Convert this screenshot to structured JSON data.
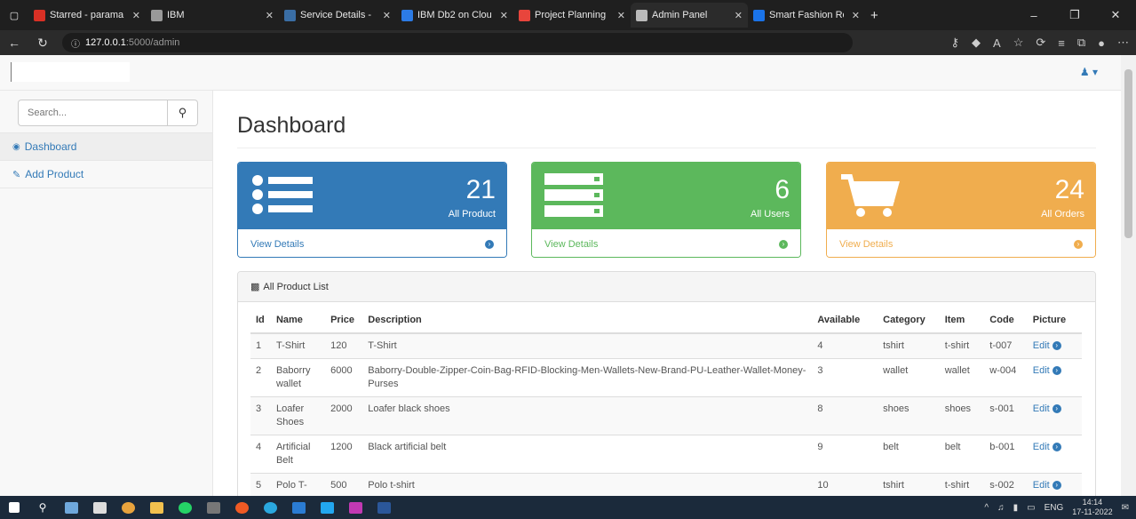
{
  "browser": {
    "tabs": [
      {
        "label": "Starred - parama",
        "color": "#d93025",
        "active": false
      },
      {
        "label": "IBM",
        "color": "#999999",
        "active": false
      },
      {
        "label": "Service Details - I",
        "color": "#3a6ea5",
        "active": false
      },
      {
        "label": "IBM Db2 on Clou",
        "color": "#2c7be5",
        "active": false
      },
      {
        "label": "Project Planning",
        "color": "#e8453c",
        "active": false
      },
      {
        "label": "Admin Panel",
        "color": "#bbbbbb",
        "active": true
      },
      {
        "label": "Smart Fashion Re",
        "color": "#1a73e8",
        "active": false
      }
    ],
    "url_host": "127.0.0.1",
    "url_path": ":5000/admin"
  },
  "sidebar": {
    "search_placeholder": "Search...",
    "items": [
      {
        "label": "Dashboard",
        "icon": "dashboard-icon"
      },
      {
        "label": "Add Product",
        "icon": "edit-icon"
      }
    ]
  },
  "main": {
    "title": "Dashboard",
    "cards": [
      {
        "count": "21",
        "label": "All Product",
        "link": "View Details",
        "color": "#337ab7",
        "icon": "list-icon"
      },
      {
        "count": "6",
        "label": "All Users",
        "link": "View Details",
        "color": "#5cb85c",
        "icon": "server-icon"
      },
      {
        "count": "24",
        "label": "All Orders",
        "link": "View Details",
        "color": "#f0ad4e",
        "icon": "cart-icon"
      }
    ],
    "list_title": "All Product List",
    "columns": [
      "Id",
      "Name",
      "Price",
      "Description",
      "Available",
      "Category",
      "Item",
      "Code",
      "Picture"
    ],
    "rows": [
      [
        "1",
        "T-Shirt",
        "120",
        "T-Shirt",
        "4",
        "tshirt",
        "t-shirt",
        "t-007",
        "Edit"
      ],
      [
        "2",
        "Baborry wallet",
        "6000",
        "Baborry-Double-Zipper-Coin-Bag-RFID-Blocking-Men-Wallets-New-Brand-PU-Leather-Wallet-Money-Purses",
        "3",
        "wallet",
        "wallet",
        "w-004",
        "Edit"
      ],
      [
        "3",
        "Loafer Shoes",
        "2000",
        "Loafer black shoes",
        "8",
        "shoes",
        "shoes",
        "s-001",
        "Edit"
      ],
      [
        "4",
        "Artificial Belt",
        "1200",
        "Black artificial belt",
        "9",
        "belt",
        "belt",
        "b-001",
        "Edit"
      ],
      [
        "5",
        "Polo T-",
        "500",
        "Polo t-shirt",
        "10",
        "tshirt",
        "t-shirt",
        "s-002",
        "Edit"
      ]
    ]
  },
  "taskbar": {
    "lang": "ENG",
    "time": "14:14",
    "date": "17-11-2022"
  }
}
